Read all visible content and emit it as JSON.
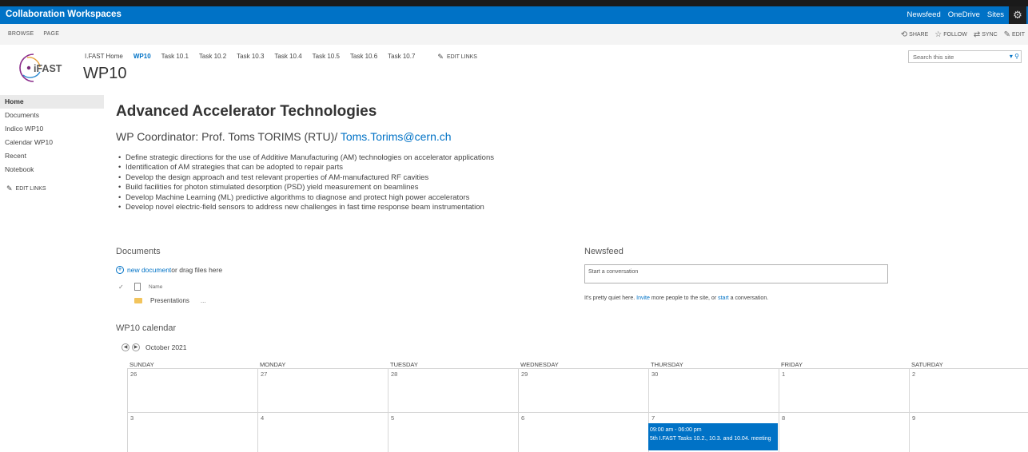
{
  "suitebar": {
    "brand": "Collaboration Workspaces",
    "links": [
      "Newsfeed",
      "OneDrive",
      "Sites"
    ],
    "gear_icon": "gear-icon"
  },
  "ribbon": {
    "tabs": [
      "BROWSE",
      "PAGE"
    ],
    "actions": [
      {
        "icon": "share-icon",
        "label": "SHARE"
      },
      {
        "icon": "star-icon",
        "label": "FOLLOW"
      },
      {
        "icon": "sync-icon",
        "label": "SYNC"
      },
      {
        "icon": "pencil-icon",
        "label": "EDIT"
      }
    ]
  },
  "site": {
    "logo_text": "iFAST",
    "title": "WP10",
    "search_placeholder": "Search this site"
  },
  "topnav": {
    "items": [
      "I.FAST Home",
      "WP10",
      "Task 10.1",
      "Task 10.2",
      "Task 10.3",
      "Task 10.4",
      "Task 10.5",
      "Task 10.6",
      "Task 10.7"
    ],
    "selected": "WP10",
    "edit_links": "EDIT LINKS"
  },
  "leftnav": {
    "items": [
      "Home",
      "Documents",
      "Indico WP10",
      "Calendar WP10",
      "Recent",
      "Notebook"
    ],
    "selected": "Home",
    "edit_links": "EDIT LINKS"
  },
  "content": {
    "heading": "Advanced Accelerator Technologies",
    "coordinator_prefix": "WP Coordinator: Prof. Toms TORIMS (RTU)/ ",
    "coordinator_email": "Toms.Torims@cern.ch",
    "bullets": [
      "Define strategic directions for the use of Additive Manufacturing (AM) technologies on accelerator applications",
      "Identification of AM strategies that can be adopted to repair parts",
      "Develop the design approach and test relevant properties of AM-manufactured RF cavities",
      "Build facilities for photon stimulated desorption (PSD) yield measurement on beamlines",
      "Develop Machine Learning (ML) predictive algorithms to diagnose and protect high power accelerators",
      "Develop novel electric-field sensors to address new challenges in fast time response beam instrumentation"
    ]
  },
  "documents": {
    "title": "Documents",
    "new_link": "new document",
    "new_suffix": " or drag files here",
    "col_name": "Name",
    "rows": [
      {
        "name": "Presentations",
        "menu": "..."
      }
    ]
  },
  "newsfeed": {
    "title": "Newsfeed",
    "placeholder": "Start a conversation",
    "quiet_prefix": "It's pretty quiet here. ",
    "invite": "Invite",
    "quiet_mid": " more people to the site, or ",
    "start": "start",
    "quiet_suffix": " a conversation."
  },
  "calendar": {
    "title": "WP10 calendar",
    "month": "October 2021",
    "days": [
      "SUNDAY",
      "MONDAY",
      "TUESDAY",
      "WEDNESDAY",
      "THURSDAY",
      "FRIDAY",
      "SATURDAY"
    ],
    "weeks": [
      [
        "26",
        "27",
        "28",
        "29",
        "30",
        "1",
        "2"
      ],
      [
        "3",
        "4",
        "5",
        "6",
        "7",
        "8",
        "9"
      ]
    ],
    "event": {
      "time": "09:00 am - 06:00 pm",
      "title": "5th I.FAST Tasks 10.2., 10.3. and 10.04. meeting"
    }
  }
}
